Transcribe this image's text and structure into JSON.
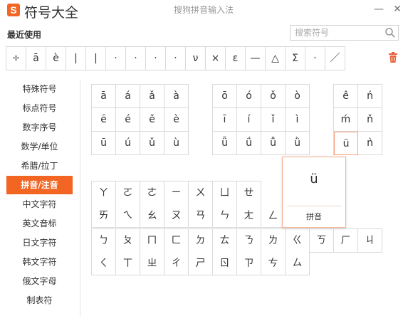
{
  "titlebar": {
    "logo_letter": "S",
    "app_title": "符号大全",
    "ime_name": "搜狗拼音输入法",
    "minimize": "—",
    "close": "✕"
  },
  "recent": {
    "label": "最近使用",
    "symbols": [
      "÷",
      "ā",
      "è",
      "|",
      "|",
      "·",
      "·",
      "·",
      "·",
      "ν",
      "×",
      "ε",
      "—",
      "△",
      "Σ",
      "·",
      "／"
    ]
  },
  "search": {
    "placeholder": "搜索符号"
  },
  "icons": {
    "search": "search-icon",
    "trash": "trash-icon"
  },
  "colors": {
    "accent": "#f26522",
    "trash": "#e8603c",
    "border": "#d9d9d9"
  },
  "sidebar": {
    "items": [
      "特殊符号",
      "标点符号",
      "数字序号",
      "数学/单位",
      "希腊/拉丁",
      "拼音/注音",
      "中文字符",
      "英文音标",
      "日文字符",
      "韩文字符",
      "俄文字母",
      "制表符"
    ],
    "active_index": 5
  },
  "pinyin": {
    "group_a": [
      [
        "ā",
        "á",
        "ǎ",
        "à"
      ],
      [
        "ē",
        "é",
        "ě",
        "è"
      ],
      [
        "ū",
        "ú",
        "ǔ",
        "ù"
      ]
    ],
    "group_o": [
      [
        "ō",
        "ó",
        "ǒ",
        "ò"
      ],
      [
        "ī",
        "í",
        "ǐ",
        "ì"
      ],
      [
        "ǖ",
        "ǘ",
        "ǚ",
        "ǜ"
      ]
    ],
    "group_e": [
      [
        "ê",
        "ń"
      ],
      [
        "ḿ",
        "ň"
      ],
      [
        "ü",
        "ǹ"
      ]
    ]
  },
  "zhuyin": {
    "row1": [
      "ㄚ",
      "ㄛ",
      "ㄜ",
      "ㄧ",
      "ㄨ",
      "ㄩ",
      "ㄝ"
    ],
    "row2": [
      "ㄞ",
      "ㄟ",
      "ㄠ",
      "ㄡ",
      "ㄢ",
      "ㄣ",
      "ㄤ",
      "ㄥ"
    ],
    "row3": [
      "ㄅ",
      "ㄆ",
      "ㄇ",
      "ㄈ",
      "ㄉ",
      "ㄊ",
      "ㄋ",
      "ㄌ",
      "ㄍ",
      "ㄎ",
      "ㄏ",
      "ㄐ"
    ],
    "row4": [
      "ㄑ",
      "ㄒ",
      "ㄓ",
      "ㄔ",
      "ㄕ",
      "ㄖ",
      "ㄗ",
      "ㄘ",
      "ㄙ"
    ]
  },
  "popup": {
    "char": "ü",
    "label": "拼音"
  }
}
